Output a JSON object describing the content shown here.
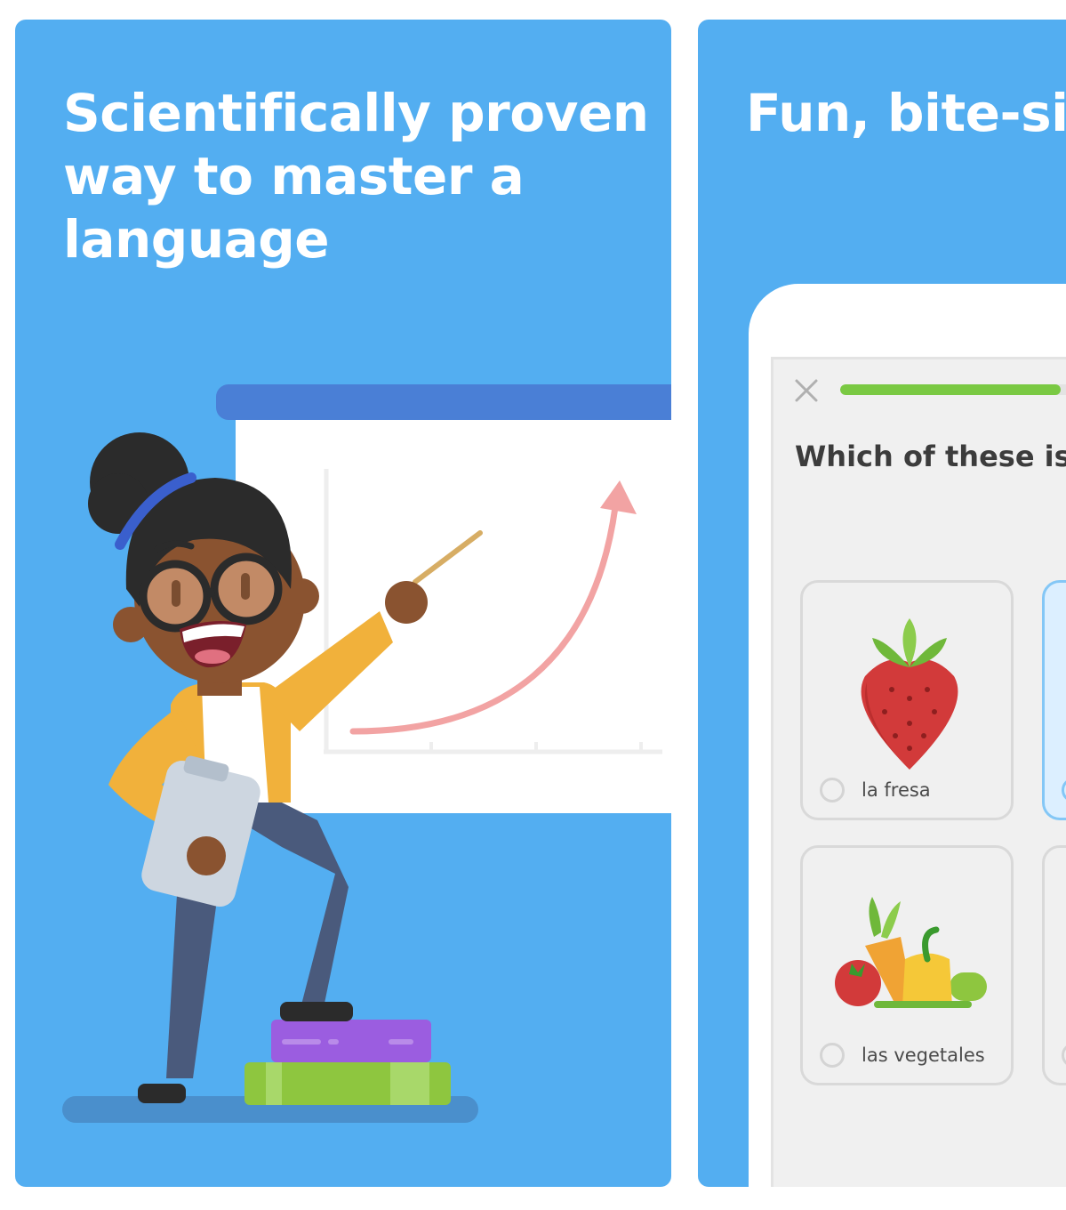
{
  "cards": [
    {
      "headline_lines": [
        "Scientifically proven",
        "way to master a",
        "language"
      ]
    },
    {
      "headline_lines": [
        "Fun, bite-sized"
      ]
    }
  ],
  "lesson": {
    "question": "Which of these is “the strawberry”?",
    "progress": 0.62,
    "close_icon": "close-icon",
    "options": [
      {
        "label": "la fresa",
        "icon": "strawberry-icon",
        "selected": false
      },
      {
        "label": "",
        "icon": "option-image",
        "selected": true
      },
      {
        "label": "las vegetales",
        "icon": "vegetables-icon",
        "selected": false
      },
      {
        "label": "",
        "icon": "option-image",
        "selected": false
      }
    ]
  },
  "colors": {
    "background_blue": "#53aef1",
    "accent_green": "#7ac943",
    "selected_blue": "#84c7f6"
  }
}
